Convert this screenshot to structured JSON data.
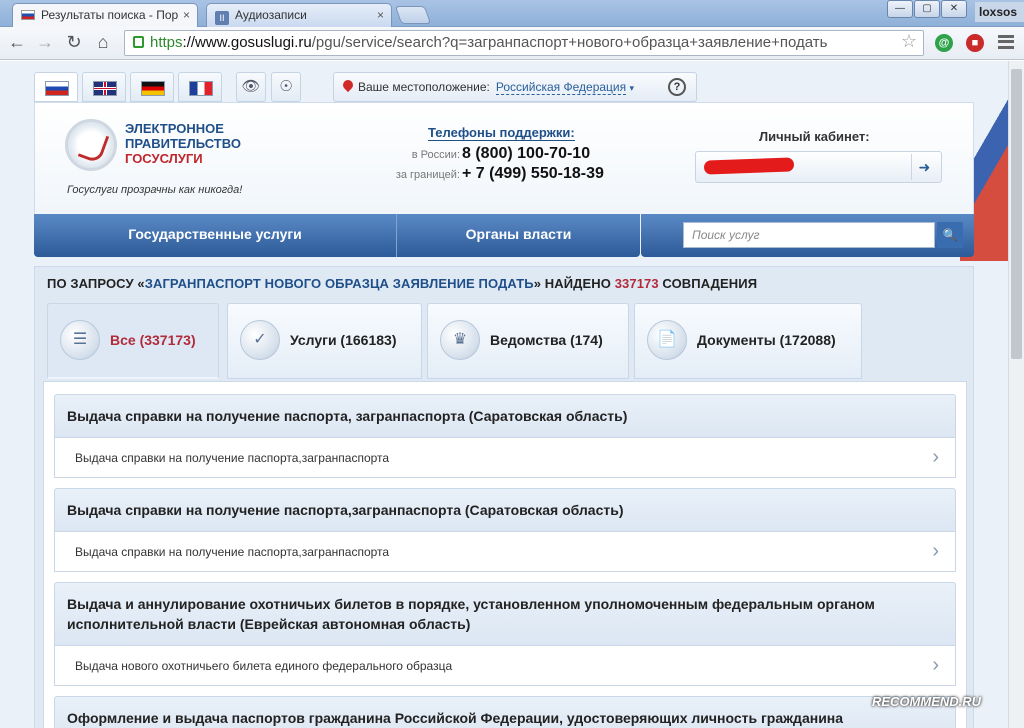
{
  "browser": {
    "tabs": [
      {
        "title": "Результаты поиска - Пор",
        "close": "×"
      },
      {
        "title": "Аудиозаписи",
        "close": "×"
      }
    ],
    "profile_name": "loxsos",
    "window_buttons": [
      "—",
      "▢",
      "✕"
    ],
    "url_scheme": "https",
    "url_host": "://www.gosuslugi.ru",
    "url_path": "/pgu/service/search?q=загранпаспорт+нового+образца+заявление+подать",
    "nav_icons": [
      "back-arrow-icon",
      "forward-arrow-icon",
      "reload-icon",
      "home-icon"
    ],
    "extensions": [
      {
        "name": "green-extension-icon",
        "color": "#2ea34a"
      },
      {
        "name": "red-extension-icon",
        "color": "#c92a2a"
      }
    ]
  },
  "site": {
    "languages": [
      "ru",
      "en",
      "de",
      "fr"
    ],
    "location_label": "Ваше местоположение:",
    "location_value": "Российская Федерация",
    "help_symbol": "?",
    "logo_line1": "ЭЛЕКТРОННОЕ",
    "logo_line2": "ПРАВИТЕЛЬСТВО",
    "logo_line3": "ГОСУСЛУГИ",
    "slogan": "Госуслуги прозрачны как никогда!",
    "phones_title": "Телефоны поддержки:",
    "phones": [
      {
        "label": "в России:",
        "number": "8 (800) 100-70-10"
      },
      {
        "label": "за границей:",
        "number": "+ 7 (499) 550-18-39"
      }
    ],
    "cabinet_title": "Личный кабинет:",
    "nav": [
      {
        "label": "Государственные услуги"
      },
      {
        "label": "Органы власти"
      }
    ],
    "search_placeholder": "Поиск услуг",
    "colors": {
      "brand_blue": "#2d5a98",
      "accent_red": "#b22b3a"
    }
  },
  "results": {
    "prefix": "ПО ЗАПРОСУ «",
    "query": "ЗАГРАНПАСПОРТ НОВОГО ОБРАЗЦА ЗАЯВЛЕНИЕ ПОДАТЬ",
    "middle": "» НАЙДЕНО ",
    "count": "337173",
    "suffix": " СОВПАДЕНИЯ",
    "tabs": [
      {
        "label": "Все (337173)",
        "icon": "list-icon"
      },
      {
        "label": "Услуги (166183)",
        "icon": "checkmark-icon"
      },
      {
        "label": "Ведомства (174)",
        "icon": "coat-of-arms-icon"
      },
      {
        "label": "Документы (172088)",
        "icon": "documents-icon"
      }
    ],
    "items": [
      {
        "title": "Выдача справки на получение паспорта, загранпаспорта (Саратовская область)",
        "sub": "Выдача справки на получение паспорта,загранпаспорта"
      },
      {
        "title": "Выдача справки на получение паспорта,загранпаспорта (Саратовская область)",
        "sub": "Выдача справки на получение паспорта,загранпаспорта"
      },
      {
        "title": "Выдача и аннулирование охотничьих билетов в порядке, установленном уполномоченным федеральным органом исполнительной власти (Еврейская автономная область)",
        "sub": "Выдача нового охотничьего билета единого федерального образца"
      },
      {
        "title": "Оформление и выдача паспортов гражданина Российской Федерации, удостоверяющих личность гражданина",
        "sub": ""
      }
    ]
  },
  "watermark": "RECOMMEND.RU"
}
